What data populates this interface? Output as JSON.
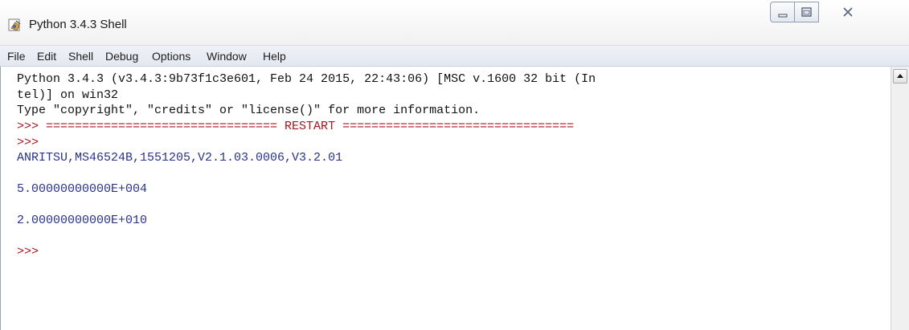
{
  "window": {
    "title": "Python 3.4.3 Shell"
  },
  "menu": {
    "items": [
      "File",
      "Edit",
      "Shell",
      "Debug",
      "Options",
      "Window",
      "Help"
    ]
  },
  "shell": {
    "lines": [
      "Python 3.4.3 (v3.4.3:9b73f1c3e601, Feb 24 2015, 22:43:06) [MSC v.1600 32 bit (In",
      "tel)] on win32",
      "Type \"copyright\", \"credits\" or \"license()\" for more information.",
      ">>> ================================ RESTART ================================",
      ">>>",
      "ANRITSU,MS46524B,1551205,V2.1.03.0006,V3.2.01",
      "",
      "5.00000000000E+004",
      "",
      "2.00000000000E+010",
      "",
      ">>>"
    ]
  },
  "colors": {
    "prompt": "#b0121e",
    "output": "#27319a",
    "text": "#111111"
  },
  "icons": {
    "app": "python-idle-icon",
    "minimize": "minimize-icon",
    "maximize": "maximize-icon",
    "close": "close-icon",
    "scroll_up": "scroll-up-arrow-icon"
  }
}
